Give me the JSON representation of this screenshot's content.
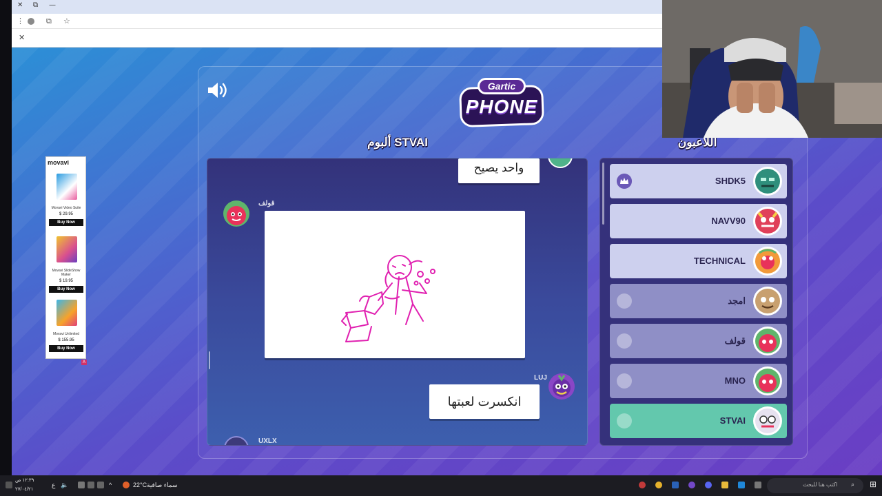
{
  "game": {
    "logo_top": "Gartic",
    "logo_bottom": "PHONE",
    "album_title": "ألبوم STVAI",
    "players_title": "اللاعبون"
  },
  "album": {
    "entries": [
      {
        "type": "text",
        "text": "واحد يصيح"
      },
      {
        "type": "drawing",
        "author": "قولف"
      },
      {
        "type": "text",
        "author": "LUJ",
        "text": "انكسرت لعبتها"
      },
      {
        "type": "next",
        "author": "UXLX"
      }
    ]
  },
  "players": [
    {
      "name": "SHDK5",
      "icon": "crown-icon",
      "state": "normal"
    },
    {
      "name": "NAVV90",
      "icon": "none",
      "state": "normal"
    },
    {
      "name": "TECHNICAL",
      "icon": "none",
      "state": "normal"
    },
    {
      "name": "امجد",
      "icon": "leave-icon",
      "state": "dim"
    },
    {
      "name": "قولف",
      "icon": "leave-icon",
      "state": "dim"
    },
    {
      "name": "MNO",
      "icon": "leave-icon",
      "state": "dim"
    },
    {
      "name": "STVAI",
      "icon": "leave-icon",
      "state": "active"
    }
  ],
  "ad": {
    "brand": "movavi",
    "items": [
      {
        "name": "Movavi Video Suite",
        "price": "$ 29.95",
        "cta": "Buy Now"
      },
      {
        "name": "Movavi SlideShow Maker",
        "price": "$ 19.95",
        "cta": "Buy Now"
      },
      {
        "name": "Movavi Unlimited",
        "price": "$ 155.95",
        "cta": "Buy Now"
      }
    ],
    "flag": "A"
  },
  "taskbar": {
    "clock_time": "١٢:٣٩ ص",
    "clock_date": "٢٧/٠٤/٢١",
    "lang": "ع",
    "weather_temp": "22°C",
    "weather_text": "سماء صافية",
    "search_placeholder": "اكتب هنا للبحث"
  },
  "colors": {
    "active_player": "#63c8ad",
    "drawing_ink": "#e020b0",
    "album_panel": "#35317b"
  }
}
